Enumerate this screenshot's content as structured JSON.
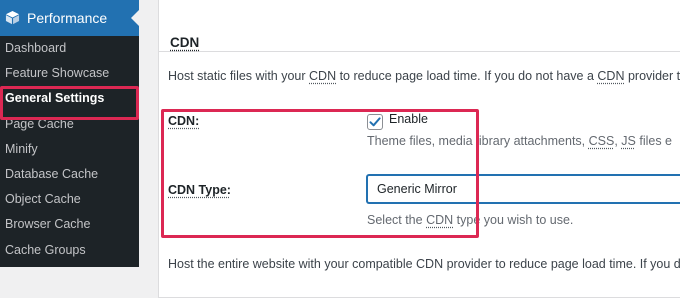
{
  "sidebar": {
    "plugin_title": "Performance",
    "icon": "w3tc-cube-icon",
    "items": [
      {
        "label": "Dashboard"
      },
      {
        "label": "Feature Showcase"
      },
      {
        "label": "General Settings",
        "current": true
      },
      {
        "label": "Page Cache"
      },
      {
        "label": "Minify"
      },
      {
        "label": "Database Cache"
      },
      {
        "label": "Object Cache"
      },
      {
        "label": "Browser Cache"
      },
      {
        "label": "Cache Groups"
      }
    ]
  },
  "section": {
    "title": "CDN",
    "intro_pre": "Host static files with your ",
    "intro_abbr": "CDN",
    "intro_mid": " to reduce page load time. If you do not have a ",
    "intro_abbr2": "CDN",
    "intro_post": " provider try"
  },
  "cdn_row": {
    "label": "CDN:",
    "checkbox_checked": true,
    "checkbox_label": "Enable",
    "desc_pre": "Theme files, media library attachments, ",
    "desc_abbr1": "CSS",
    "desc_mid": ", ",
    "desc_abbr2": "JS",
    "desc_post": " files e"
  },
  "cdn_type_row": {
    "label": "CDN Type:",
    "selected_value": "Generic Mirror",
    "desc_pre": "Select the ",
    "desc_abbr": "CDN",
    "desc_post": " type you wish to use."
  },
  "footer": {
    "text": "Host the entire website with your compatible CDN provider to reduce page load time. If you do not"
  },
  "colors": {
    "accent": "#2271b1",
    "highlight": "#dc2853",
    "sidebar_bg": "#1d2327"
  }
}
